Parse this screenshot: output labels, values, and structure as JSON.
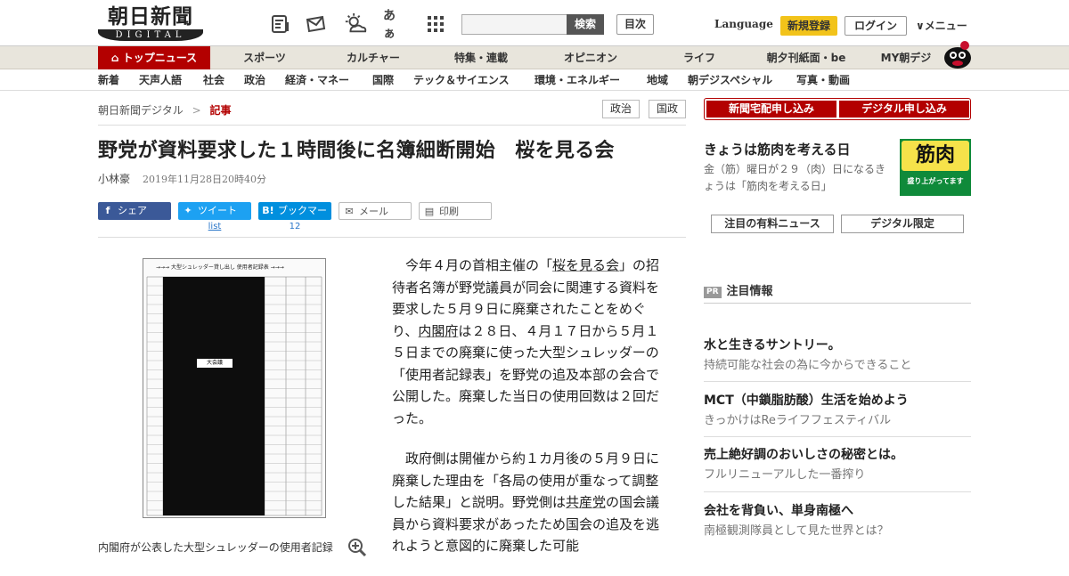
{
  "logo": {
    "line1": "朝日新聞",
    "line2": "DIGITAL"
  },
  "header": {
    "icons": [
      "newspaper-icon",
      "mail-icon",
      "weather-icon",
      "font-size-icon",
      "grid-menu-icon"
    ],
    "font_icon_text": "あぁ",
    "search_placeholder": "",
    "search_label": "検索",
    "toc_label": "目次",
    "language": "Language",
    "signup": "新規登録",
    "login": "ログイン",
    "menu": "メニュー"
  },
  "nav1": [
    "トップニュース",
    "スポーツ",
    "カルチャー",
    "特集・連載",
    "オピニオン",
    "ライフ",
    "朝夕刊紙面・be",
    "MY朝デジ"
  ],
  "nav2": [
    "新着",
    "天声人語",
    "社会",
    "政治",
    "経済・マネー",
    "国際",
    "テック＆サイエンス",
    "環境・エネルギー",
    "地域",
    "朝デジスペシャル",
    "写真・動画"
  ],
  "breadcrumb": {
    "home": "朝日新聞デジタル",
    "sep": ">",
    "current": "記事"
  },
  "tags": [
    "政治",
    "国政"
  ],
  "article": {
    "title": "野党が資料要求した１時間後に名簿細断開始　桜を見る会",
    "author": "小林豪",
    "datetime": "2019年11月28日20時40分",
    "share": {
      "facebook": "シェア",
      "twitter": "ツイート",
      "hatena": "ブックマーク",
      "mail": "メール",
      "print": "印刷",
      "twitter_count": "list",
      "hatena_count": "12"
    },
    "image_header": "→→→ 大型シュレッダー貸し出し 使用者記録表 →→→",
    "image_stamp": "大会議",
    "caption": "内閣府が公表した大型シュレッダーの使用者記録",
    "p1_a": "今年４月の首相主催の「",
    "p1_link1": "桜を見る会",
    "p1_b": "」の招待者名簿が野党議員が同会に関連する資料を要求した５月９日に廃棄されたことをめぐり、",
    "p1_link2": "内閣府",
    "p1_c": "は２８日、４月１７日から５月１５日までの廃棄に使った大型シュレッダーの「使用者記録表」を野党の追及本部の会合で公開した。廃棄した当日の使用回数は２回だった。",
    "p2_a": "政府側は開催から約１カ月後の５月９日に廃棄した理由を「各局の使用が重なって調整した結果」と説明。野党側は",
    "p2_link": "共産党",
    "p2_b": "の国会議員から資料要求があったため国会の追及を逃れようと意図的に廃棄した可能"
  },
  "sidebar": {
    "btn_delivery": "新聞宅配申し込み",
    "btn_digital": "デジタル申し込み",
    "promo_title": "きょうは筋肉を考える日",
    "promo_text": "金（筋）曜日が２９（肉）日になるきょうは「筋肉を考える日」",
    "promo_img_big": "筋肉",
    "promo_img_small": "盛り上がってます",
    "tab1": "注目の有料ニュース",
    "tab2": "デジタル限定",
    "pr_badge": "PR",
    "pr_heading": "注目情報",
    "pr_items": [
      {
        "title": "水と生きるサントリー。",
        "sub": "持続可能な社会の為に今からできること"
      },
      {
        "title": "MCT（中鎖脂肪酸）生活を始めよう",
        "sub": "きっかけはReライフフェスティバル"
      },
      {
        "title": "売上絶好調のおいしさの秘密とは。",
        "sub": "フルリニューアルした一番搾り"
      },
      {
        "title": "会社を背負い、単身南極へ",
        "sub": "南極観測隊員として見た世界とは？"
      }
    ]
  },
  "colors": {
    "brand_red": "#b30000",
    "signup_yellow": "#f2c31a",
    "facebook": "#3b5998",
    "twitter": "#1da1f2",
    "hatena": "#008fde"
  }
}
